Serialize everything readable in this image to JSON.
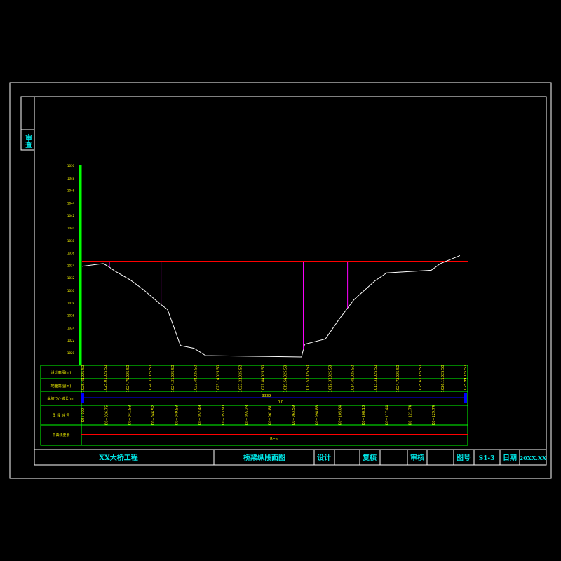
{
  "side_stamp": "审查",
  "profile": {
    "elevation_ticks": [
      "1050",
      "1048",
      "1046",
      "1044",
      "1042",
      "1040",
      "1038",
      "1036",
      "1034",
      "1032",
      "1030",
      "1028",
      "1026",
      "1024",
      "1022",
      "1020"
    ],
    "terrain": [
      [
        1029.3,
        1024.3
      ],
      [
        1034.2,
        1024.7
      ],
      [
        1035.5,
        1024.2
      ],
      [
        1036.8,
        1023.6
      ],
      [
        1040.5,
        1022.2
      ],
      [
        1043.4,
        1020.8
      ],
      [
        1047.2,
        1018.7
      ],
      [
        1049.0,
        1017.8
      ],
      [
        1052.0,
        1012.4
      ],
      [
        1055.1,
        1012.0
      ],
      [
        1057.8,
        1010.9
      ],
      [
        1068.7,
        1010.8
      ],
      [
        1079.9,
        1010.7
      ],
      [
        1080.6,
        1012.6
      ],
      [
        1085.4,
        1013.4
      ],
      [
        1088.5,
        1016.3
      ],
      [
        1092.0,
        1019.3
      ],
      [
        1096.8,
        1022.1
      ],
      [
        1099.5,
        1023.3
      ],
      [
        1109.8,
        1023.7
      ],
      [
        1111.9,
        1024.7
      ],
      [
        1116.4,
        1025.9
      ]
    ],
    "design_line_elevation": 1025.0,
    "pier_stations": [
      1035.6,
      1047.5,
      1080.3,
      1090.5
    ]
  },
  "table": {
    "row_labels": [
      "设计高程(m)",
      "地面高程(m)",
      "纵坡(%)·坡长(m)",
      "里  程  桩  号",
      "平曲线要素"
    ],
    "design_elev": [
      "1025.50",
      "1025.50",
      "1025.50",
      "1025.50",
      "1025.50",
      "1025.50",
      "1025.50",
      "1025.50",
      "1025.50",
      "1025.50",
      "1025.50",
      "1025.50",
      "1025.50",
      "1025.50",
      "1025.50",
      "1025.50",
      "1025.50",
      "1025.50"
    ],
    "ground_elev": [
      "1025.48",
      "1025.01",
      "1024.75",
      "1024.31",
      "1024.31",
      "1023.48",
      "1023.16",
      "1022.23",
      "1021.88",
      "1019.56",
      "1013.52",
      "1012.37",
      "1014.45",
      "1013.33",
      "1024.72",
      "1025.67",
      "1026.11",
      "1025.99"
    ],
    "slope_top": "3339",
    "slope_bottom": "0.0",
    "stations": [
      "K0+000",
      "K0+026.75",
      "K0+041.58",
      "K0+046.52",
      "K0+049.53",
      "K0+052.49",
      "K0+053.90",
      "K0+055.28",
      "K0+061.81",
      "K0+063.59",
      "K0+098.83",
      "K0+105.04",
      "K0+108.13",
      "K0+117.44",
      "K0+121.74",
      "K0+129.74"
    ],
    "curve_label": "R=∞"
  },
  "title_block": {
    "project": "XX大桥工程",
    "drawing": "桥梁纵段面图",
    "design_label": "设计",
    "review_label": "复核",
    "audit_label": "审核",
    "number_label": "图号",
    "number_value": "S1-3",
    "date_label": "日期",
    "date_value": "20XX.XX"
  },
  "colors": {
    "frame": "#ffffff",
    "inner_frame": "#00ff00",
    "design_line": "#ff0000",
    "pier": "#ff00ff",
    "terrain": "#ffffff",
    "text": "#ffff00",
    "title_text": "#00e6e6",
    "slope_line": "#0000ff"
  }
}
